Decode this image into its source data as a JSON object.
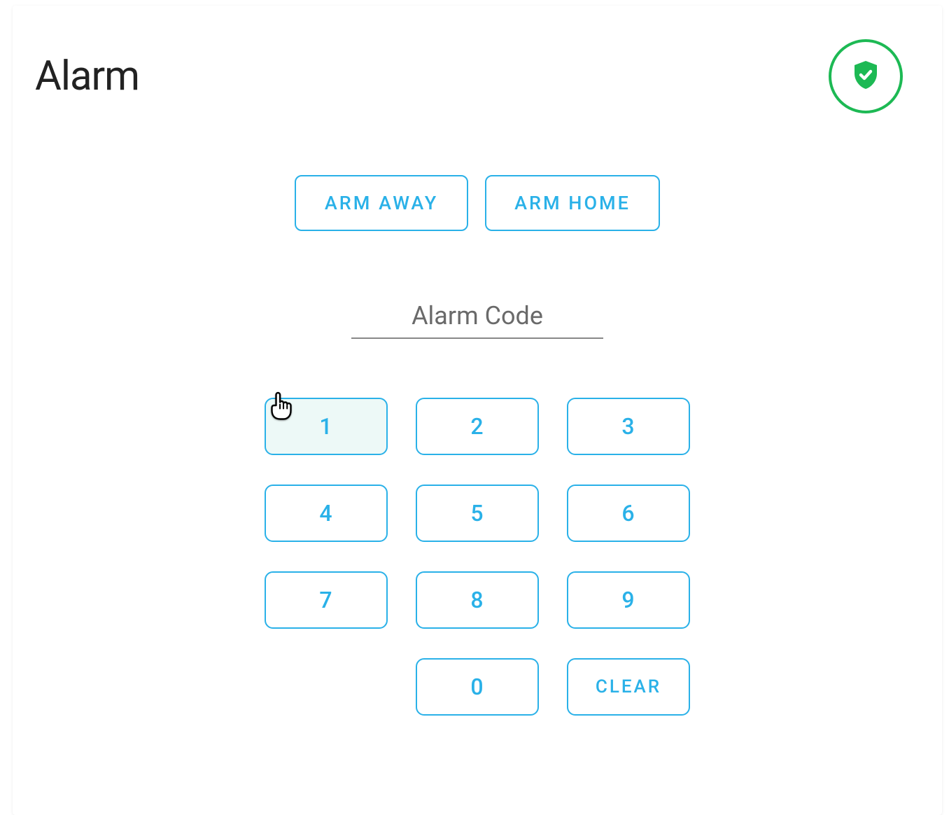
{
  "header": {
    "title": "Alarm"
  },
  "status": {
    "icon": "shield-check-icon",
    "color": "#1db954"
  },
  "arm_buttons": {
    "away": "ARM AWAY",
    "home": "ARM HOME"
  },
  "code_input": {
    "placeholder": "Alarm Code",
    "value": ""
  },
  "keypad": {
    "k1": "1",
    "k2": "2",
    "k3": "3",
    "k4": "4",
    "k5": "5",
    "k6": "6",
    "k7": "7",
    "k8": "8",
    "k9": "9",
    "k0": "0",
    "clear": "CLEAR"
  },
  "colors": {
    "accent": "#2ab1e8",
    "status_green": "#1db954"
  }
}
